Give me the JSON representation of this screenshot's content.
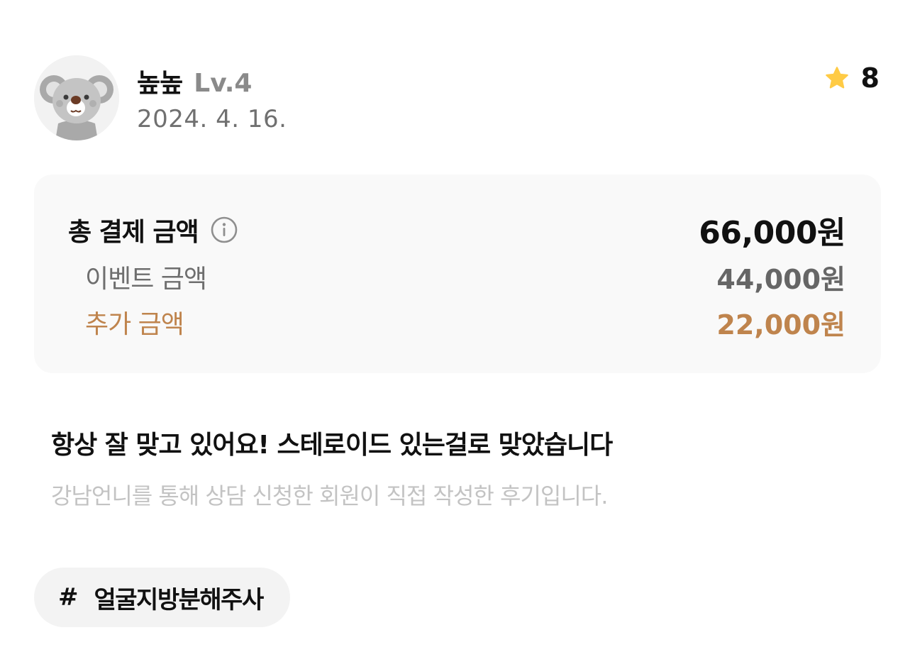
{
  "user": {
    "nickname": "높높",
    "level": "Lv.4",
    "date": "2024. 4. 16.",
    "avatar_icon": "koala-avatar-icon"
  },
  "rating": {
    "icon": "star-icon",
    "value": "8",
    "star_color": "#FFCB45"
  },
  "price": {
    "total_label": "총 결제 금액",
    "total_value": "66,000원",
    "event_label": "이벤트 금액",
    "event_value": "44,000원",
    "extra_label": "추가 금액",
    "extra_value": "22,000원",
    "accent_color": "#BF844D",
    "info_icon": "info-icon"
  },
  "review": {
    "text": "항상 잘 맞고 있어요! 스테로이드 있는걸로 맞았습니다",
    "notice": "강남언니를 통해 상담 신청한 회원이 직접 작성한 후기입니다."
  },
  "tag": {
    "hash": "#",
    "label": "얼굴지방분해주사"
  }
}
